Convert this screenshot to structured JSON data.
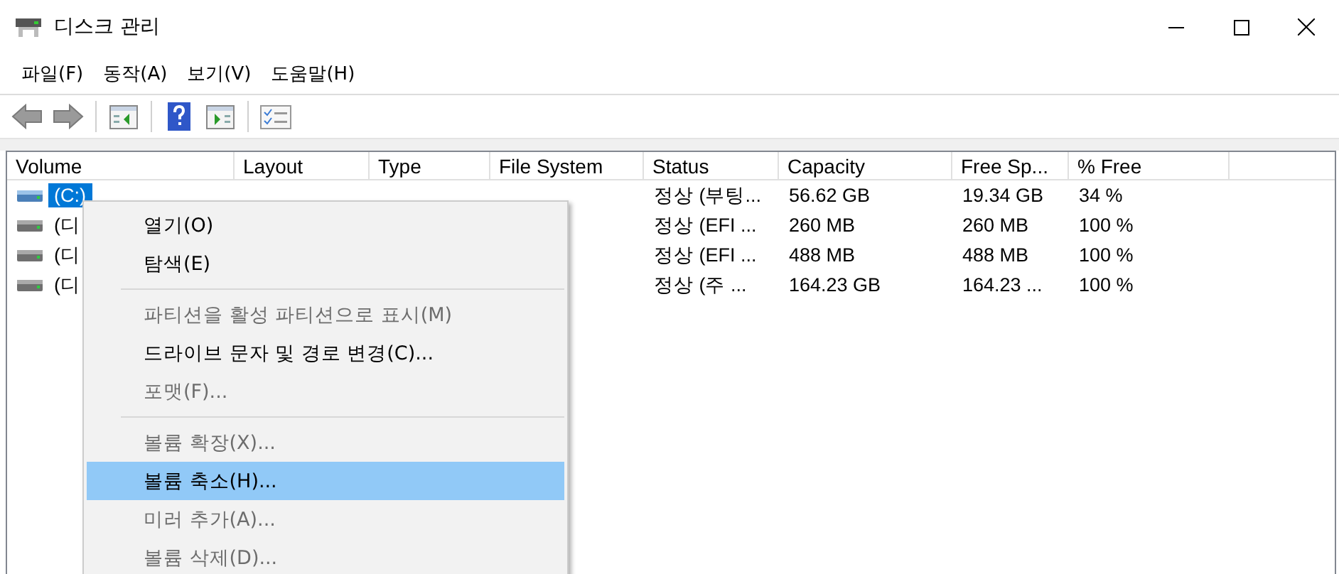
{
  "window": {
    "title": "디스크 관리"
  },
  "menubar": [
    "파일(F)",
    "동작(A)",
    "보기(V)",
    "도움말(H)"
  ],
  "toolbar": [
    {
      "kind": "back"
    },
    {
      "kind": "forward"
    },
    {
      "kind": "separator"
    },
    {
      "kind": "panel-left"
    },
    {
      "kind": "separator"
    },
    {
      "kind": "help"
    },
    {
      "kind": "panel-right"
    },
    {
      "kind": "separator"
    },
    {
      "kind": "checklist"
    }
  ],
  "table": {
    "columns": [
      "Volume",
      "Layout",
      "Type",
      "File System",
      "Status",
      "Capacity",
      "Free Sp...",
      "% Free"
    ],
    "rows": [
      {
        "selected": true,
        "cells": [
          "(C:)",
          "",
          "",
          "",
          "정상 (부팅...",
          "56.62 GB",
          "19.34 GB",
          "34 %"
        ]
      },
      {
        "selected": false,
        "cells": [
          "(디",
          "",
          "",
          "",
          "정상 (EFI ...",
          "260 MB",
          "260 MB",
          "100 %"
        ]
      },
      {
        "selected": false,
        "cells": [
          "(디",
          "",
          "",
          "",
          "정상 (EFI ...",
          "488 MB",
          "488 MB",
          "100 %"
        ]
      },
      {
        "selected": false,
        "cells": [
          "(디",
          "",
          "",
          "",
          "정상 (주 ...",
          "164.23 GB",
          "164.23 ...",
          "100 %"
        ]
      }
    ]
  },
  "context_menu": [
    {
      "kind": "item",
      "label": "열기(O)",
      "disabled": false,
      "selected": false
    },
    {
      "kind": "item",
      "label": "탐색(E)",
      "disabled": false,
      "selected": false
    },
    {
      "kind": "separator"
    },
    {
      "kind": "item",
      "label": "파티션을 활성 파티션으로 표시(M)",
      "disabled": true,
      "selected": false
    },
    {
      "kind": "item",
      "label": "드라이브 문자 및 경로 변경(C)...",
      "disabled": false,
      "selected": false
    },
    {
      "kind": "item",
      "label": "포맷(F)...",
      "disabled": true,
      "selected": false
    },
    {
      "kind": "separator"
    },
    {
      "kind": "item",
      "label": "볼륨 확장(X)...",
      "disabled": true,
      "selected": false
    },
    {
      "kind": "item",
      "label": "볼륨 축소(H)...",
      "disabled": false,
      "selected": true
    },
    {
      "kind": "item",
      "label": "미러 추가(A)...",
      "disabled": true,
      "selected": false
    },
    {
      "kind": "item",
      "label": "볼륨 삭제(D)...",
      "disabled": true,
      "selected": false
    }
  ]
}
